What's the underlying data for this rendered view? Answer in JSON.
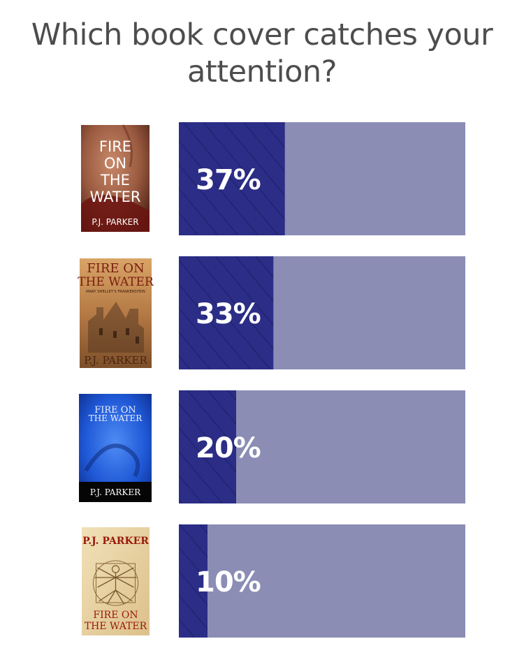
{
  "question": {
    "line1": "Which book cover catches your",
    "line2": "attention?"
  },
  "covers": [
    {
      "title_lines": [
        "FIRE",
        "ON",
        "THE",
        "WATER"
      ],
      "author": "P.J. PARKER",
      "style": "nude-torso"
    },
    {
      "title_lines": [
        "FIRE ON",
        "THE WATER"
      ],
      "subtitle": "MARY SHELLEY'S FRANKENSTEIN",
      "author": "P.J. PARKER",
      "style": "castle"
    },
    {
      "title_lines": [
        "FIRE ON",
        "THE WATER"
      ],
      "author": "P.J. PARKER",
      "style": "blue-figure"
    },
    {
      "title_lines": [
        "FIRE ON",
        "THE WATER"
      ],
      "author": "P.J. PARKER",
      "style": "vitruvian"
    }
  ],
  "chart_data": {
    "type": "bar",
    "orientation": "horizontal",
    "title": "Which book cover catches your attention?",
    "categories": [
      "Cover 1",
      "Cover 2",
      "Cover 3",
      "Cover 4"
    ],
    "values": [
      37,
      33,
      20,
      10
    ],
    "labels": [
      "37%",
      "33%",
      "20%",
      "10%"
    ],
    "unit": "%",
    "xlim": [
      0,
      100
    ],
    "grid": false,
    "legend": "none",
    "colors": {
      "bar_fill": "#2b2d87",
      "bar_hatch": "#1a1c5c",
      "track": "#8b8db5",
      "label": "#ffffff"
    }
  }
}
